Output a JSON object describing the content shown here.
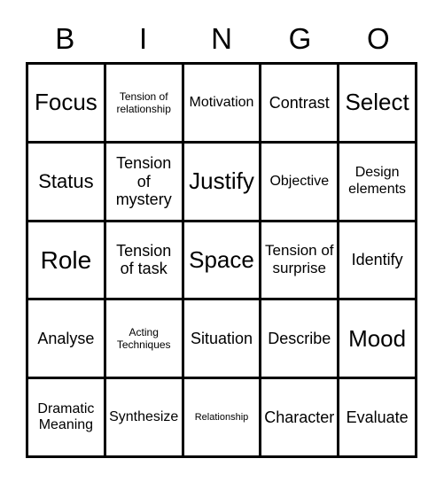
{
  "card": {
    "header_letters": [
      "B",
      "I",
      "N",
      "G",
      "O"
    ],
    "columns": 5,
    "rows": 5,
    "text_color": "#000000",
    "background_color": "#ffffff",
    "border_color": "#000000"
  },
  "cells": [
    {
      "text": "Focus",
      "size": "xl"
    },
    {
      "text": "Tension of relationship",
      "size": "xxs"
    },
    {
      "text": "Motivation",
      "size": "s"
    },
    {
      "text": "Contrast",
      "size": "m"
    },
    {
      "text": "Select",
      "size": "xl"
    },
    {
      "text": "Status",
      "size": "l"
    },
    {
      "text": "Tension of mystery",
      "size": "m"
    },
    {
      "text": "Justify",
      "size": "xl"
    },
    {
      "text": "Objective",
      "size": "s"
    },
    {
      "text": "Design elements",
      "size": "s"
    },
    {
      "text": "Role",
      "size": "xxl"
    },
    {
      "text": "Tension of task",
      "size": "m"
    },
    {
      "text": "Space",
      "size": "xl"
    },
    {
      "text": "Tension of surprise",
      "size": "ms"
    },
    {
      "text": "Identify",
      "size": "m"
    },
    {
      "text": "Analyse",
      "size": "m"
    },
    {
      "text": "Acting Techniques",
      "size": "xxs"
    },
    {
      "text": "Situation",
      "size": "m"
    },
    {
      "text": "Describe",
      "size": "m"
    },
    {
      "text": "Mood",
      "size": "xl"
    },
    {
      "text": "Dramatic Meaning",
      "size": "s"
    },
    {
      "text": "Synthesize",
      "size": "s"
    },
    {
      "text": "Relationship",
      "size": "min"
    },
    {
      "text": "Character",
      "size": "m"
    },
    {
      "text": "Evaluate",
      "size": "m"
    }
  ]
}
